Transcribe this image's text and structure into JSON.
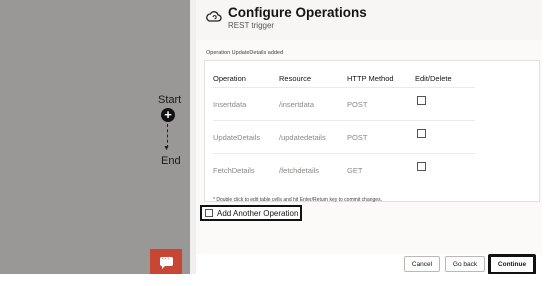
{
  "canvas": {
    "start_label": "Start",
    "end_label": "End",
    "add_symbol": "+"
  },
  "panel": {
    "title": "Configure Operations",
    "subtitle": "REST trigger",
    "status_message": "Operation UpdateDetails added",
    "table": {
      "headers": [
        "Operation",
        "Resource",
        "HTTP Method",
        "Edit/Delete"
      ],
      "rows": [
        {
          "operation": "Insertdata",
          "resource": "/insertdata",
          "method": "POST"
        },
        {
          "operation": "UpdateDetails",
          "resource": "/updatedetails",
          "method": "POST"
        },
        {
          "operation": "FetchDetails",
          "resource": "/fetchdetails",
          "method": "GET"
        }
      ]
    },
    "footnote": "* Double click to edit table cells and hit Enter/Return key to commit changes.",
    "add_another_label": "Add Another Operation"
  },
  "footer": {
    "cancel_label": "Cancel",
    "go_back_label": "Go back",
    "continue_label": "Continue"
  },
  "icons": {
    "header_icon": "cloud-refresh-icon",
    "chat_icon": "chat-bubble-icon"
  },
  "colors": {
    "canvas_bg": "#9a9896",
    "chat_button": "#c74634",
    "header_bg": "#f7f6f5"
  }
}
